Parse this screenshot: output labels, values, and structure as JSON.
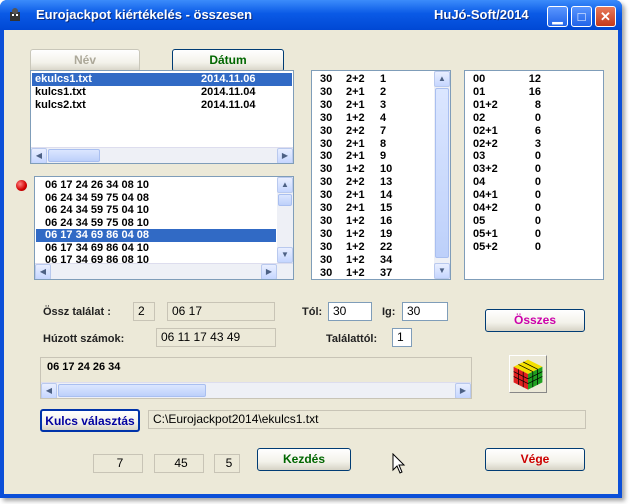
{
  "window": {
    "title": "Eurojackpot kiértékelés - összesen",
    "brand": "HuJó-Soft/2014"
  },
  "buttons": {
    "nev": "Név",
    "datum": "Dátum",
    "osszes": "Összes",
    "kulcs": "Kulcs választás",
    "kezdes": "Kezdés",
    "vege": "Vége"
  },
  "files": [
    {
      "name": "ekulcs1.txt",
      "date": "2014.11.06"
    },
    {
      "name": "kulcs1.txt",
      "date": "2014.11.04"
    },
    {
      "name": "kulcs2.txt",
      "date": "2014.11.04"
    }
  ],
  "combos": [
    "06 17 24 26 34 08 10",
    "06 24 34 59 75 04 08",
    "06 24 34 59 75 04 10",
    "06 24 34 59 75 08 10",
    "06 17 34 69 86 04 08",
    "06 17 34 69 86 04 10",
    "06 17 34 69 86 08 10"
  ],
  "results": [
    [
      "30",
      "2+2",
      "1"
    ],
    [
      "30",
      "2+1",
      "2"
    ],
    [
      "30",
      "2+1",
      "3"
    ],
    [
      "30",
      "1+2",
      "4"
    ],
    [
      "30",
      "2+2",
      "7"
    ],
    [
      "30",
      "2+1",
      "8"
    ],
    [
      "30",
      "2+1",
      "9"
    ],
    [
      "30",
      "1+2",
      "10"
    ],
    [
      "30",
      "2+2",
      "13"
    ],
    [
      "30",
      "2+1",
      "14"
    ],
    [
      "30",
      "2+1",
      "15"
    ],
    [
      "30",
      "1+2",
      "16"
    ],
    [
      "30",
      "1+2",
      "19"
    ],
    [
      "30",
      "1+2",
      "22"
    ],
    [
      "30",
      "1+2",
      "34"
    ],
    [
      "30",
      "1+2",
      "37"
    ]
  ],
  "summary": [
    [
      "00",
      "12"
    ],
    [
      "01",
      "16"
    ],
    [
      "01+2",
      "8"
    ],
    [
      "02",
      "0"
    ],
    [
      "02+1",
      "6"
    ],
    [
      "02+2",
      "3"
    ],
    [
      "03",
      "0"
    ],
    [
      "03+2",
      "0"
    ],
    [
      "04",
      "0"
    ],
    [
      "04+1",
      "0"
    ],
    [
      "04+2",
      "0"
    ],
    [
      "05",
      "0"
    ],
    [
      "05+1",
      "0"
    ],
    [
      "05+2",
      "0"
    ]
  ],
  "labels": {
    "ossz": "Össz találat :",
    "huzott": "Húzott számok:",
    "tol": "Tól:",
    "ig": "Ig:",
    "talalattol": "Találattól:"
  },
  "values": {
    "ossz_count": "2",
    "ossz_nums": "06 17",
    "huzott": "06 11 17 43 49",
    "tol": "30",
    "ig": "30",
    "talalattol": "1",
    "bottom_list": "06 17 24 26 34",
    "path": "C:\\Eurojackpot2014\\ekulcs1.txt",
    "num1": "7",
    "num2": "45",
    "num3": "5"
  }
}
